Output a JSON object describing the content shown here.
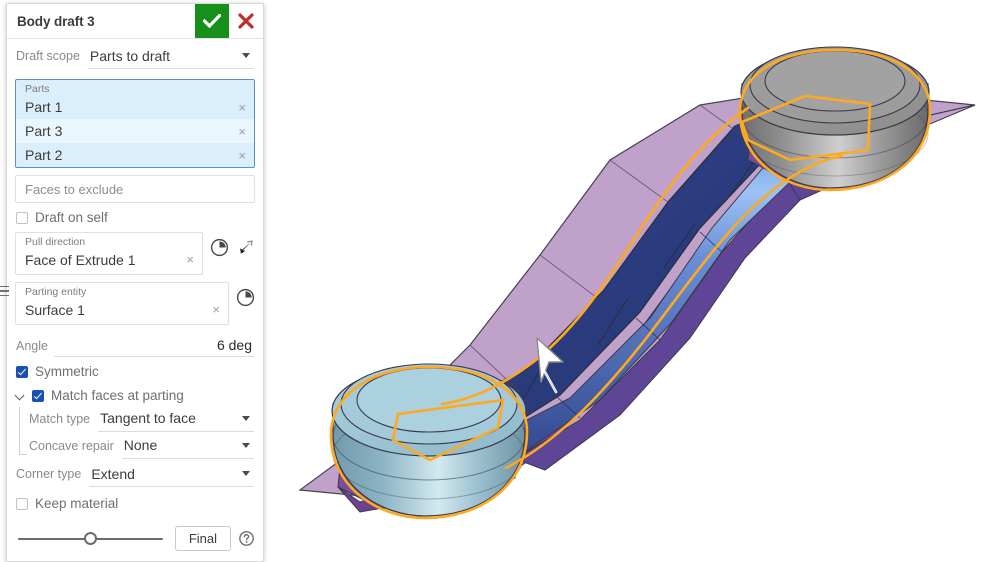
{
  "dialog": {
    "title": "Body draft 3",
    "accept_icon": "check-icon",
    "cancel_icon": "x-icon",
    "accept_color": "#17901b",
    "cancel_color": "#c22b2b",
    "draft_scope": {
      "label": "Draft scope",
      "value": "Parts to draft"
    },
    "parts_list": {
      "caption": "Parts",
      "items": [
        {
          "name": "Part 1",
          "remove": "×"
        },
        {
          "name": "Part 3",
          "remove": "×"
        },
        {
          "name": "Part 2",
          "remove": "×"
        }
      ],
      "selection_border": "#5b8fc9",
      "selection_fill": "#dbeefb"
    },
    "faces_to_exclude": {
      "placeholder": "Faces to exclude"
    },
    "draft_on_self": {
      "label": "Draft on self",
      "checked": false
    },
    "pull_direction": {
      "label": "Pull direction",
      "value": "Face of Extrude 1",
      "remove": "×",
      "history_icon": "clock-icon",
      "flip_icon": "flip-direction-arrow-icon"
    },
    "parting_entity": {
      "label": "Parting entity",
      "value": "Surface 1",
      "remove": "×",
      "history_icon": "clock-icon"
    },
    "angle": {
      "label": "Angle",
      "value": "6 deg"
    },
    "symmetric": {
      "label": "Symmetric",
      "checked": true
    },
    "match_faces": {
      "label": "Match faces at parting",
      "checked": true,
      "expanded": true
    },
    "match_type": {
      "label": "Match type",
      "value": "Tangent to face"
    },
    "concave_repair": {
      "label": "Concave repair",
      "value": "None"
    },
    "corner_type": {
      "label": "Corner type",
      "value": "Extend"
    },
    "keep_material": {
      "label": "Keep material",
      "checked": false
    },
    "footer": {
      "slider_value": 50,
      "quality_button": "Final",
      "help_icon": "help-circle-icon"
    },
    "drag_handle_icon": "drag-handle-icon"
  },
  "viewport": {
    "background": "#ffffff",
    "colors": {
      "body_blue_dark": "#2c3f86",
      "body_blue_mid": "#3a55a8",
      "body_blue_light": "#7fa9e8",
      "plane_purple_light": "#bd9cc8",
      "plane_purple_dark": "#7b4d9e",
      "cylinder_gray_light": "#b9b9b9",
      "cylinder_gray_dark": "#757575",
      "cylinder_teal_light": "#a8cdd9",
      "cylinder_teal_dark": "#6f97a8",
      "highlight_orange": "#ffa91e",
      "edge_dark": "#3a3a4a",
      "cursor_white": "#ffffff"
    },
    "selected_edge_color": "#ffa91e",
    "direction_arrow": "pull-direction-arrow",
    "model_name": "s-curved-link-with-two-bosses"
  }
}
